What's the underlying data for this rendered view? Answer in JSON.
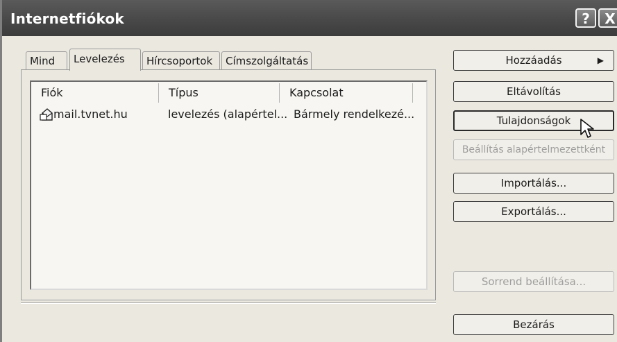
{
  "window": {
    "title": "Internetfiókok",
    "help_label": "?",
    "close_label": "X"
  },
  "tabs": [
    {
      "label": "Mind",
      "active": false
    },
    {
      "label": "Levelezés",
      "active": true
    },
    {
      "label": "Hírcsoportok",
      "active": false
    },
    {
      "label": "Címszolgáltatás",
      "active": false
    }
  ],
  "list": {
    "columns": [
      "Fiók",
      "Típus",
      "Kapcsolat"
    ],
    "rows": [
      {
        "account": "mail.tvnet.hu",
        "type": "levelezés (alapértel...",
        "connection": "Bármely rendelkezé...",
        "icon": "mail-account-icon"
      }
    ]
  },
  "buttons": {
    "add": "Hozzáadás",
    "remove": "Eltávolítás",
    "properties": "Tulajdonságok",
    "set_default": "Beállítás alapértelmezettként",
    "import": "Importálás...",
    "export": "Exportálás...",
    "order": "Sorrend beállítása...",
    "close": "Bezárás"
  },
  "icons": {
    "submenu_arrow": "▶",
    "cursor": "mouse-pointer-icon"
  },
  "colors": {
    "titlebar": "#4a4a4a",
    "face": "#ebe8e0",
    "list_bg": "#f7f6f2"
  }
}
